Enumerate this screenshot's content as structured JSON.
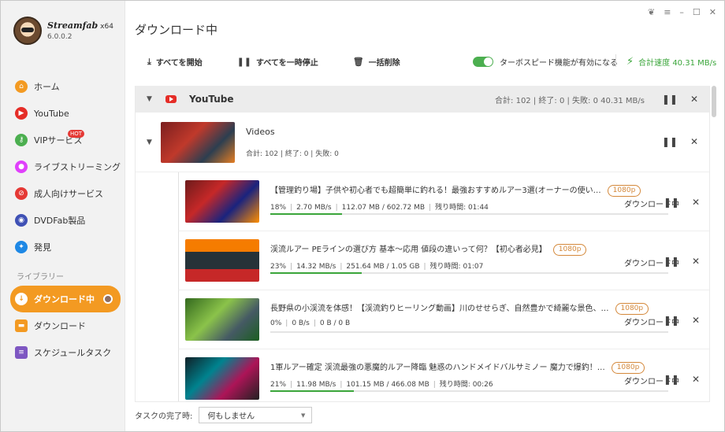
{
  "app": {
    "name": "Streamfab",
    "arch": "x64",
    "version": "6.0.0.2"
  },
  "window_controls": [
    "❦",
    "≡",
    "–",
    "☐",
    "✕"
  ],
  "sidebar": {
    "items": [
      {
        "label": "ホーム",
        "icon": "home-icon",
        "color": "#f39a22"
      },
      {
        "label": "YouTube",
        "icon": "youtube-icon",
        "color": "#e52d27"
      },
      {
        "label": "VIPサービス",
        "icon": "key-icon",
        "color": "#4caf50",
        "badge": "HOT"
      },
      {
        "label": "ライブストリーミング",
        "icon": "live-icon",
        "color": "#e040fb"
      },
      {
        "label": "成人向けサービス",
        "icon": "adult-icon",
        "color": "#e53935"
      },
      {
        "label": "DVDFab製品",
        "icon": "dvdfab-icon",
        "color": "#3f51b5"
      },
      {
        "label": "発見",
        "icon": "compass-icon",
        "color": "#1e88e5"
      }
    ],
    "library_label": "ライブラリー",
    "library": [
      {
        "label": "ダウンロード中",
        "icon": "download-icon",
        "active": true
      },
      {
        "label": "ダウンロード",
        "icon": "folder-icon",
        "color": "#f39a22"
      },
      {
        "label": "スケジュールタスク",
        "icon": "schedule-icon",
        "color": "#7e57c2"
      }
    ]
  },
  "header": {
    "title": "ダウンロード中"
  },
  "toolbar": {
    "start_all": "すべてを開始",
    "pause_all": "すべてを一時停止",
    "delete_all": "一括削除",
    "turbo_label": "ターボスピード機能が有効になる",
    "total_speed": "合計速度 40.31 MB/s"
  },
  "group": {
    "title": "YouTube",
    "stats": "合計: 102  |  終了: 0  |  失敗: 0     40.31 MB/s"
  },
  "subgroup": {
    "title": "Videos",
    "stats": "合計: 102  |  終了: 0  |  失敗: 0"
  },
  "items": [
    {
      "title": "【管理釣り場】子供や初心者でも超簡単に釣れる！最強おすすめルアー3選(オーナーの使い…",
      "res": "1080p",
      "percent": "18%",
      "speed": "2.70 MB/s",
      "size": "112.07 MB / 602.72 MB",
      "remaining": "残り時間: 01:44",
      "status": "ダウンロード中",
      "progress": 18
    },
    {
      "title": "渓流ルアー PEラインの選び方 基本～応用 値段の違いって何？【初心者必見】",
      "res": "1080p",
      "percent": "23%",
      "speed": "14.32 MB/s",
      "size": "251.64 MB / 1.05 GB",
      "remaining": "残り時間: 01:07",
      "status": "ダウンロード中",
      "progress": 23
    },
    {
      "title": "長野県の小渓流を体感！【渓流釣りヒーリング動画】川のせせらぎ、自然豊かで綺麗な景色、…",
      "res": "1080p",
      "percent": "0%",
      "speed": "0 B/s",
      "size": "0 B / 0 B",
      "remaining": "",
      "status": "ダウンロード中",
      "progress": 0
    },
    {
      "title": "1軍ルアー確定 渓流最強の悪魔的ルアー降臨 魅惑のハンドメイドバルサミノー 魔力で爆釣！…",
      "res": "1080p",
      "percent": "21%",
      "speed": "11.98 MB/s",
      "size": "101.15 MB / 466.08 MB",
      "remaining": "残り時間: 00:26",
      "status": "ダウンロード中",
      "progress": 21
    }
  ],
  "footer": {
    "label": "タスクの完了時:",
    "option": "何もしません"
  }
}
